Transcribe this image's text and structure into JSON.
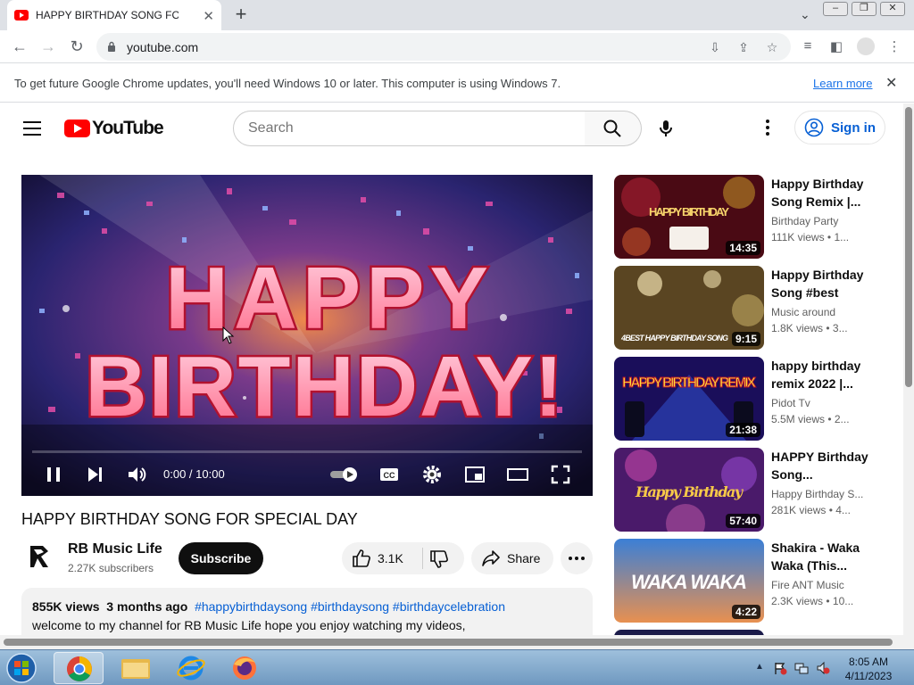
{
  "browser": {
    "tab_title": "HAPPY BIRTHDAY SONG FOR",
    "url": "youtube.com",
    "infobar_message": "To get future Google Chrome updates, you'll need Windows 10 or later. This computer is using Windows 7.",
    "infobar_link": "Learn more"
  },
  "youtube": {
    "logo_text": "YouTube",
    "search_placeholder": "Search",
    "sign_in": "Sign in",
    "video": {
      "title": "HAPPY BIRTHDAY SONG FOR SPECIAL DAY",
      "time": "0:00 / 10:00",
      "overlay_line1": "HAPPY",
      "overlay_line2": "BIRTHDAY!"
    },
    "channel": {
      "name": "RB Music Life",
      "subscribers": "2.27K subscribers",
      "subscribe_label": "Subscribe"
    },
    "actions": {
      "likes": "3.1K",
      "share": "Share"
    },
    "description": {
      "views": "855K views",
      "age": "3 months ago",
      "tags": "#happybirthdaysong #birthdaysong #birthdaycelebration",
      "text": "welcome to my channel for RB Music Life  hope you enjoy watching my videos,"
    },
    "recommendations": [
      {
        "title": "Happy Birthday Song Remix |...",
        "channel": "Birthday Party",
        "meta": "111K views  • 1...",
        "duration": "14:35",
        "thumb_text": "HAPPY BIRTHDAY"
      },
      {
        "title": "Happy Birthday Song #best",
        "channel": "Music around",
        "meta": "1.8K views  • 3...",
        "duration": "9:15",
        "thumb_text": "4BEST HAPPY BIRTHDAY SONG"
      },
      {
        "title": "happy birthday remix 2022 |...",
        "channel": "Pidot Tv",
        "meta": "5.5M views  • 2...",
        "duration": "21:38",
        "thumb_text": "HAPPY BIRTHDAY REMIX"
      },
      {
        "title": "HAPPY Birthday Song...",
        "channel": "Happy Birthday S...",
        "meta": "281K views  • 4...",
        "duration": "57:40",
        "thumb_text": "Happy Birthday"
      },
      {
        "title": "Shakira - Waka Waka (This...",
        "channel": "Fire ANT Music",
        "meta": "2.3K views  • 10...",
        "duration": "4:22",
        "thumb_text": "WAKA WAKA"
      }
    ]
  },
  "taskbar": {
    "time": "8:05 AM",
    "date": "4/11/2023"
  },
  "colors": {
    "youtube_red": "#ff0000",
    "link_blue": "#065fd4",
    "chrome_tab_strip": "#dee1e6"
  }
}
